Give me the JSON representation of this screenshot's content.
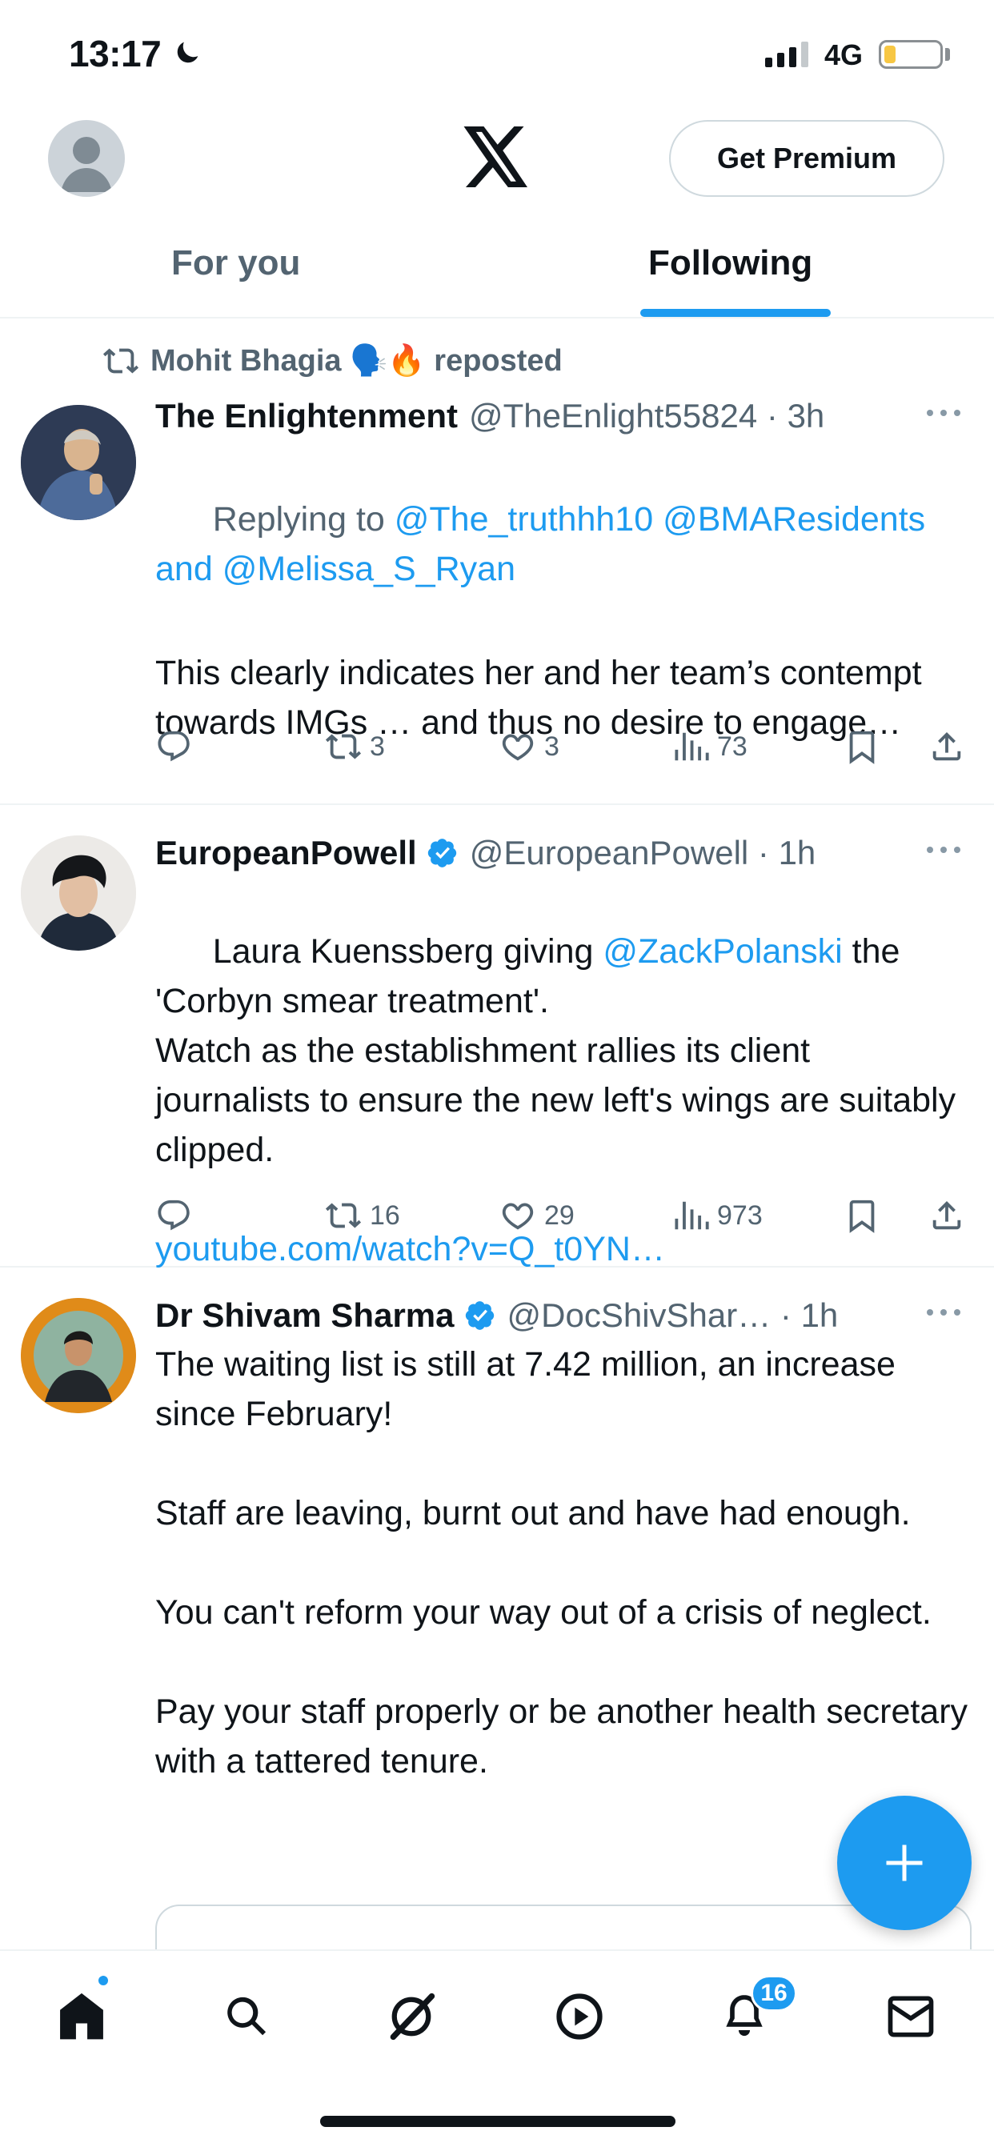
{
  "status_bar": {
    "time": "13:17",
    "network": "4G",
    "battery_level": 0.2
  },
  "header": {
    "premium_label": "Get Premium"
  },
  "tabs": [
    {
      "label": "For you",
      "active": false
    },
    {
      "label": "Following",
      "active": true
    }
  ],
  "posts": [
    {
      "repost_by": "Mohit Bhagia 🗣️🔥 reposted",
      "author": "The Enlightenment",
      "handle": "@TheEnlight55824",
      "time": "3h",
      "verified": false,
      "reply_prefix": "Replying to ",
      "reply_to_1": "@The_truthhh10",
      "reply_to_2": "@BMAResidents",
      "reply_and": "and ",
      "reply_to_3": "@Melissa_S_Ryan",
      "text": "This clearly indicates her and her team’s contempt towards IMGs … and thus no desire to engage…",
      "retweets": "3",
      "likes": "3",
      "views": "73"
    },
    {
      "author": "EuropeanPowell",
      "handle": "@EuropeanPowell",
      "time": "1h",
      "verified": true,
      "text_before": "Laura Kuenssberg giving ",
      "mention": "@ZackPolanski",
      "text_after": " the 'Corbyn smear treatment'.\nWatch as the establishment rallies its client journalists to ensure the new left's wings are suitably clipped.",
      "link": "youtube.com/watch?v=Q_t0YN…",
      "retweets": "16",
      "likes": "29",
      "views": "973"
    },
    {
      "author": "Dr Shivam Sharma",
      "handle": "@DocShivShar…",
      "time": "1h",
      "verified": true,
      "text": "The waiting list is still at 7.42 million, an increase since February!\n\nStaff are leaving, burnt out and have had enough.\n\nYou can't reform your way out of a crisis of neglect.\n\nPay your staff properly or be another health secretary with a tattered tenure."
    }
  ],
  "bottom_nav": {
    "notifications_count": "16"
  },
  "colors": {
    "accent": "#1d9bf0",
    "text": "#0f1419",
    "muted": "#536471",
    "divider": "#eff3f4"
  }
}
